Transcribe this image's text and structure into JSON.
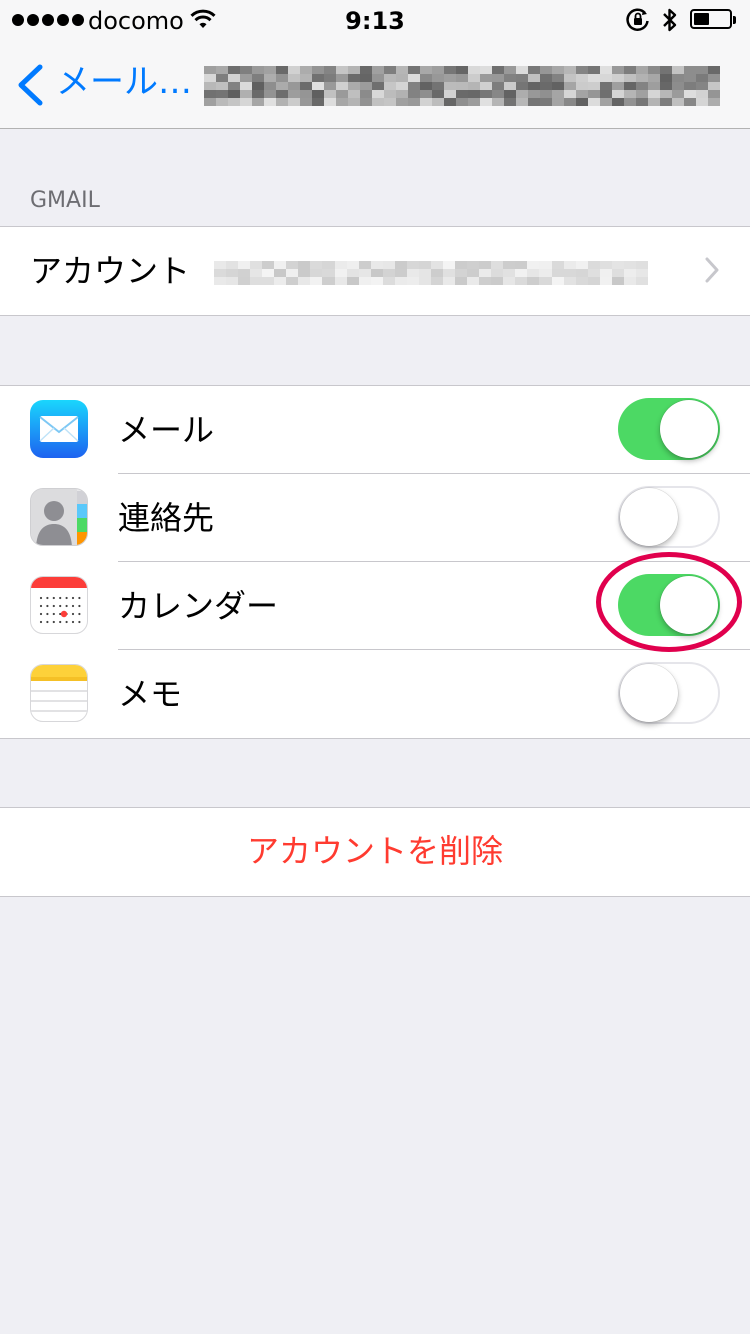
{
  "status_bar": {
    "carrier": "docomo",
    "time": "9:13",
    "icons": [
      "signal-dots-icon",
      "wifi-icon",
      "rotation-lock-icon",
      "bluetooth-icon",
      "battery-icon"
    ],
    "battery_level": 0.45
  },
  "nav": {
    "back_label": "メール…",
    "title_redacted": true
  },
  "account_section": {
    "header": "GMAIL",
    "account_label": "アカウント",
    "account_value_redacted": true
  },
  "services": [
    {
      "label": "メール",
      "icon": "mail-app-icon",
      "enabled": true
    },
    {
      "label": "連絡先",
      "icon": "contacts-app-icon",
      "enabled": false
    },
    {
      "label": "カレンダー",
      "icon": "calendar-app-icon",
      "enabled": true,
      "highlighted": true
    },
    {
      "label": "メモ",
      "icon": "notes-app-icon",
      "enabled": false
    }
  ],
  "delete_account": {
    "label": "アカウントを削除"
  },
  "colors": {
    "accent": "#007aff",
    "toggle_on": "#4cd964",
    "destructive": "#ff3b30",
    "highlight": "#e0004d",
    "background": "#efeff4"
  }
}
